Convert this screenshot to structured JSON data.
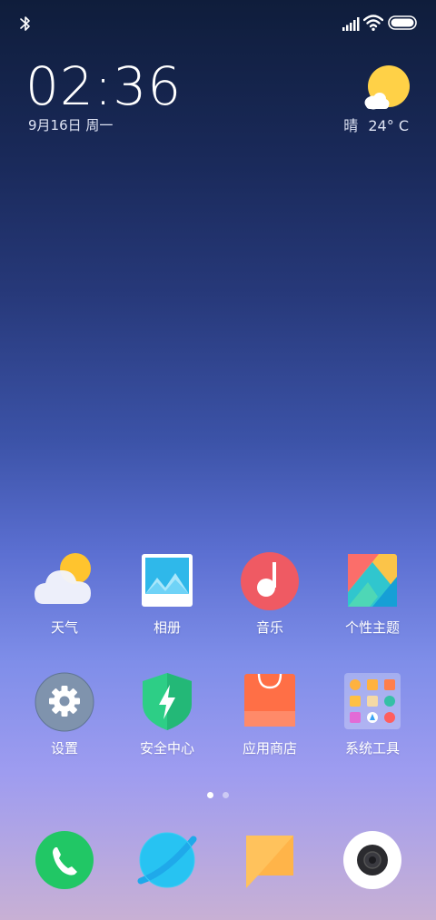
{
  "status_bar": {
    "icons": [
      "bluetooth-icon",
      "signal-icon",
      "wifi-icon",
      "battery-icon"
    ]
  },
  "clock": {
    "time": "02:36",
    "date": "9月16日 周一"
  },
  "weather": {
    "condition": "晴",
    "temperature": "24° C",
    "icon": "sunny-cloud-icon"
  },
  "apps": [
    {
      "label": "天气",
      "icon": "weather-app-icon"
    },
    {
      "label": "相册",
      "icon": "gallery-app-icon"
    },
    {
      "label": "音乐",
      "icon": "music-app-icon"
    },
    {
      "label": "个性主题",
      "icon": "themes-app-icon"
    },
    {
      "label": "设置",
      "icon": "settings-app-icon"
    },
    {
      "label": "安全中心",
      "icon": "security-app-icon"
    },
    {
      "label": "应用商店",
      "icon": "app-store-icon"
    },
    {
      "label": "系统工具",
      "icon": "system-tools-folder-icon"
    }
  ],
  "page_indicator": {
    "total": 2,
    "current": 1
  },
  "dock": [
    {
      "icon": "phone-app-icon"
    },
    {
      "icon": "browser-app-icon"
    },
    {
      "icon": "messages-app-icon"
    },
    {
      "icon": "camera-app-icon"
    }
  ],
  "colors": {
    "phone": "#21c765",
    "browser": "#27c3f2",
    "messages": "#ffc25c",
    "music": "#ef5a63",
    "security": "#2dce86",
    "store": "#ff734a",
    "settings": "#7f93ad"
  }
}
